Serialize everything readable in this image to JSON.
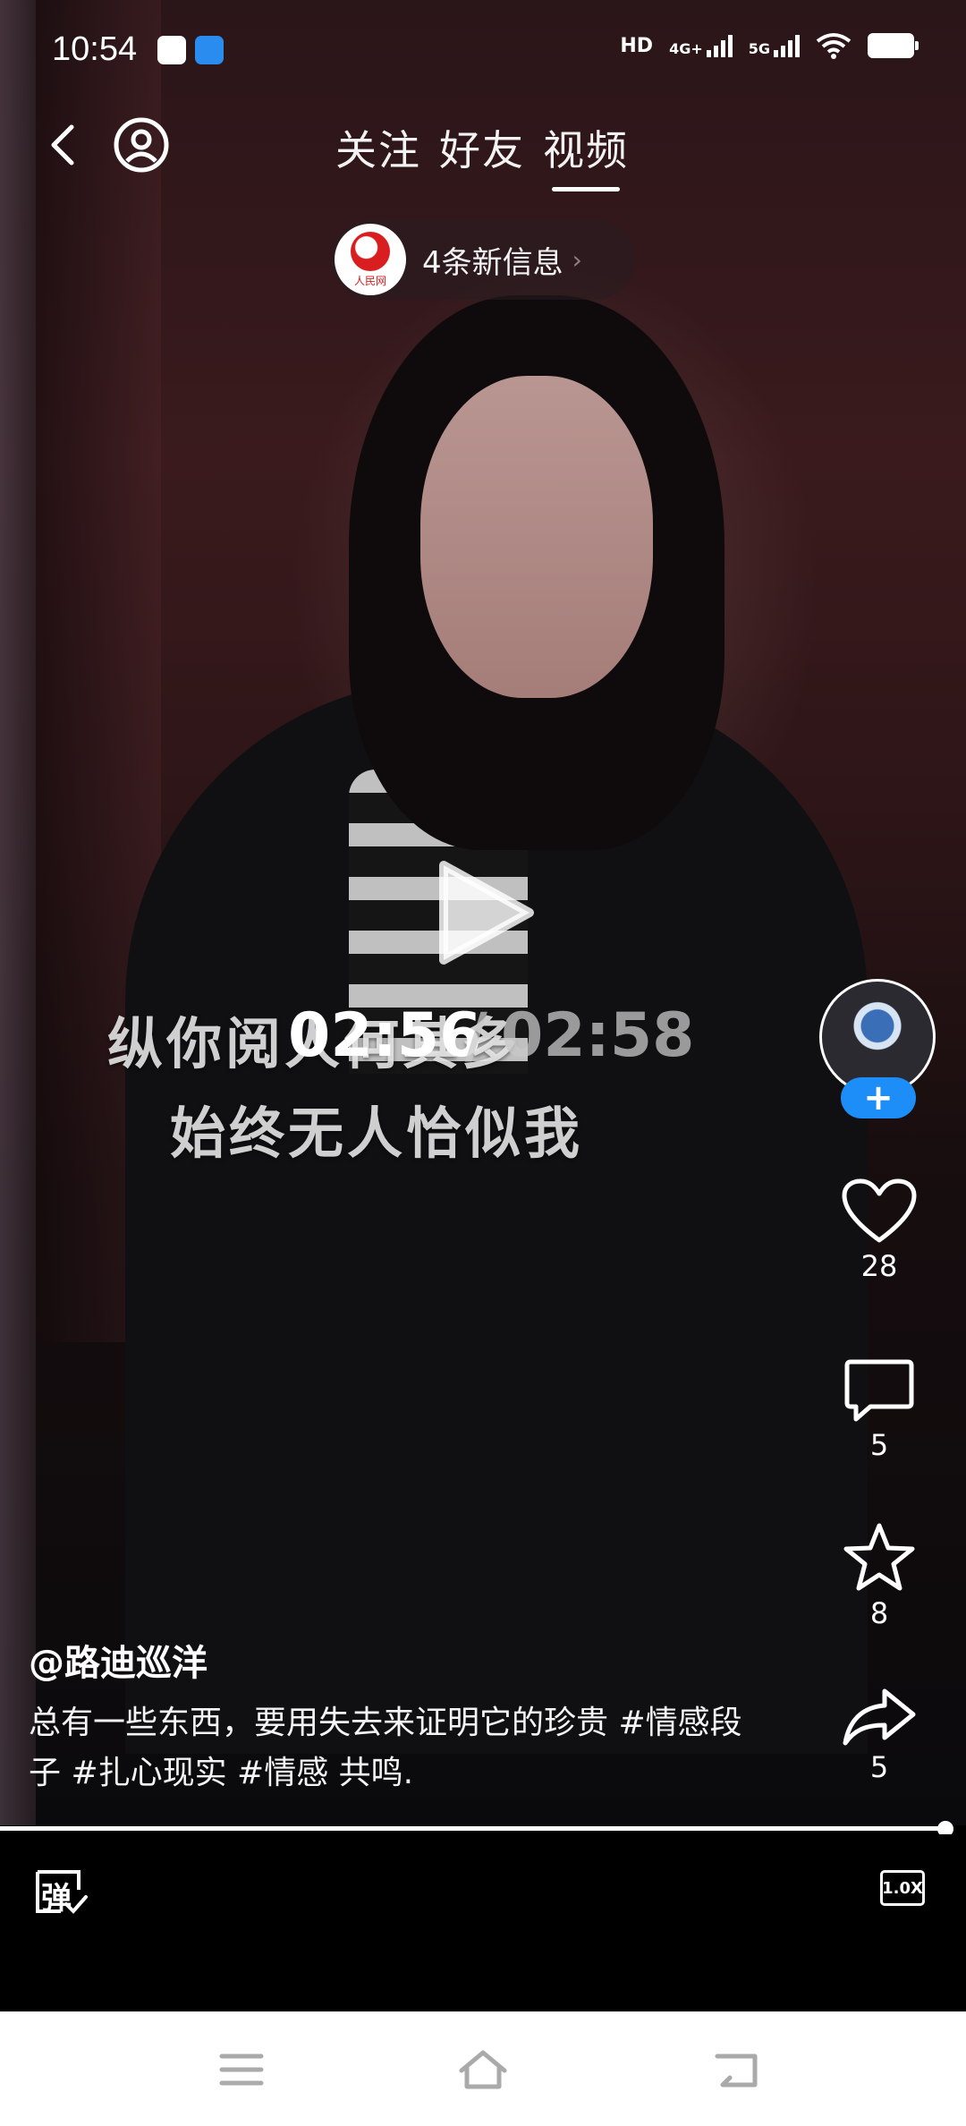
{
  "status_bar": {
    "time": "10:54",
    "network_hd": "HD",
    "network_4g": "4G+",
    "network_5g": "5G"
  },
  "nav": {
    "tabs": [
      {
        "label": "关注",
        "active": false
      },
      {
        "label": "好友",
        "active": false
      },
      {
        "label": "视频",
        "active": true
      }
    ]
  },
  "notice": {
    "logo_text": "人民网",
    "text": "4条新信息"
  },
  "video": {
    "subtitle_line1": "纵你阅人何其多",
    "subtitle_line2": "始终无人恰似我",
    "current_time": "02:56",
    "separator": "/",
    "total_time": "02:58",
    "progress_fraction": 0.99
  },
  "actions": {
    "likes": "28",
    "comments": "5",
    "favorites": "8",
    "shares": "5",
    "follow_symbol": "+"
  },
  "caption": {
    "user": "@路迪巡洋",
    "text": "总有一些东西，要用失去来证明它的珍贵 #情感段子 #扎心现实 #情感 共鸣."
  },
  "bottom": {
    "speed": "1.0X",
    "danmu": "弹"
  },
  "colors": {
    "follow_blue": "#1d8df7",
    "logo_red": "#d81e1e"
  }
}
